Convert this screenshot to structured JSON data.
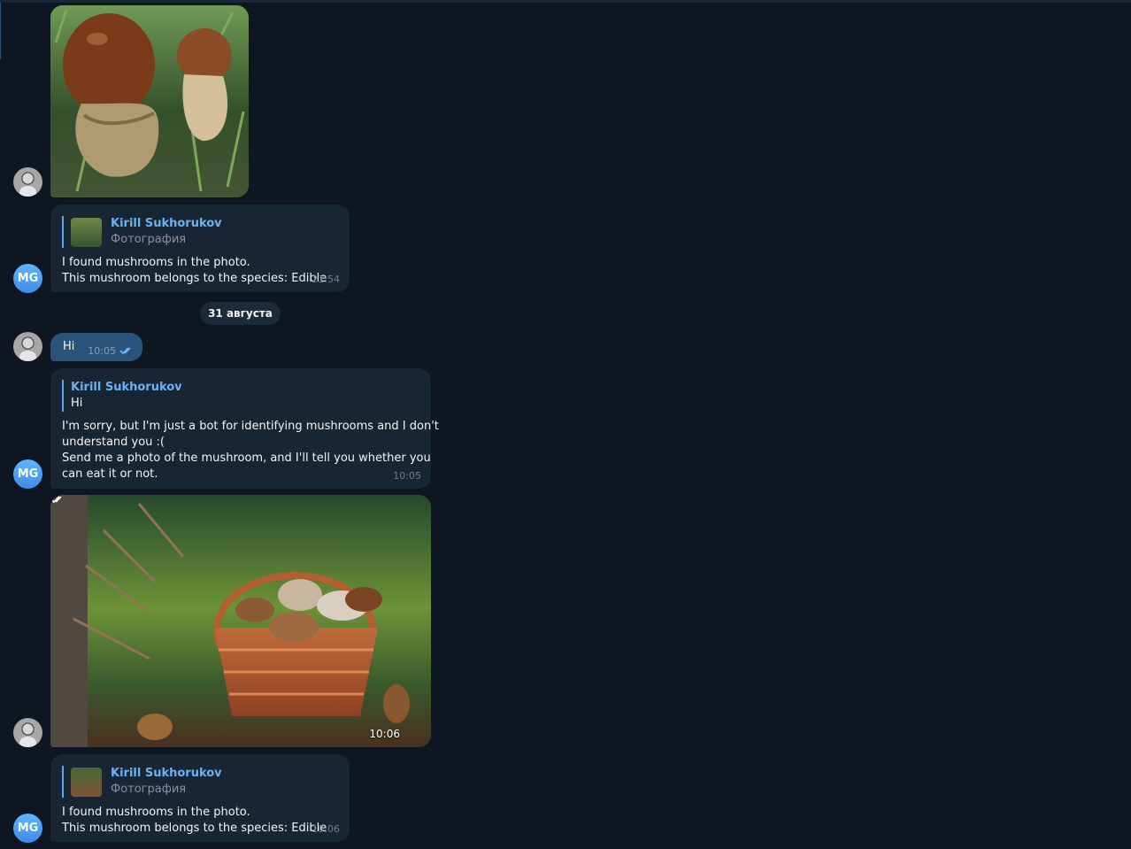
{
  "messages": {
    "reply_name": "Kirill Sukhorukov",
    "photo_label": "Фотография",
    "result_line1": "I found mushrooms in the photo.",
    "result_line2": "This mushroom belongs to the species: Edible",
    "time_first_result": "21:54",
    "date_separator": "31 августа",
    "hi_text": "Hi",
    "hi_time": "10:05",
    "bot_reply_quote": "Hi",
    "bot_reply_line1": "I'm sorry, but I'm just a bot for identifying mushrooms and I don't",
    "bot_reply_line2": "understand you :(",
    "bot_reply_line3": "Send me a photo of the mushroom, and I'll tell you whether you",
    "bot_reply_line4": "can eat it or not.",
    "bot_reply_time": "10:05",
    "basket_time": "10:06",
    "second_result_time": "10:06"
  },
  "avatars": {
    "bot_initials": "MG",
    "user_avatar_icon": "user-photo-avatar",
    "bot_avatar_color": "#4a97ef"
  },
  "colors": {
    "background": "#0e1621",
    "incoming_bubble": "#182533",
    "outgoing_bubble": "#2b5278",
    "link_name": "#6ab3f3"
  }
}
